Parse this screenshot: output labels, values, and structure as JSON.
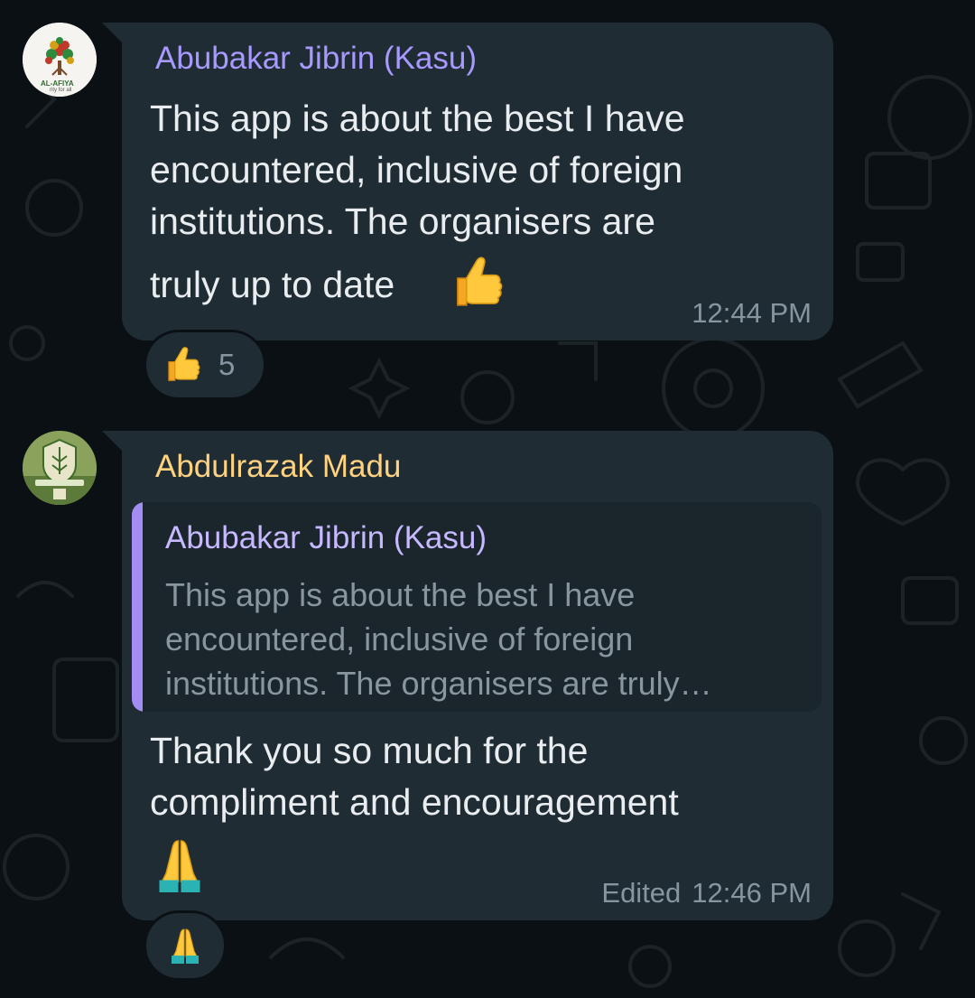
{
  "messages": [
    {
      "sender": "Abubakar Jibrin (Kasu)",
      "sender_color": "#a899ff",
      "text_lines": [
        "This app is about the best I have",
        "encountered, inclusive of foreign",
        "institutions. The organisers are",
        "truly up to date"
      ],
      "inline_emoji": "thumbs-up",
      "time": "12:44 PM",
      "reactions": [
        {
          "emoji": "thumbs-up",
          "count": "5"
        }
      ],
      "avatar": {
        "name": "al-afiya-logo",
        "label": "AL-AFIYA",
        "tagline": "rity for all"
      }
    },
    {
      "sender": "Abdulrazak Madu",
      "sender_color": "#ffd280",
      "quote": {
        "sender": "Abubakar Jibrin (Kasu)",
        "text": "This app is about the best I have encountered, inclusive of foreign institutions. The organisers are truly…",
        "bar_color": "#a38df5"
      },
      "text_lines": [
        "Thank you so much for the",
        "compliment and encouragement"
      ],
      "trailing_emoji": "folded-hands",
      "edited_label": "Edited",
      "time": "12:46 PM",
      "reactions": [
        {
          "emoji": "folded-hands",
          "count": ""
        }
      ],
      "avatar": {
        "name": "university-crest-logo"
      }
    }
  ],
  "colors": {
    "bubble": "#1f2c34",
    "background": "#0b1014",
    "text": "#e9edef",
    "meta": "#8696a0"
  }
}
